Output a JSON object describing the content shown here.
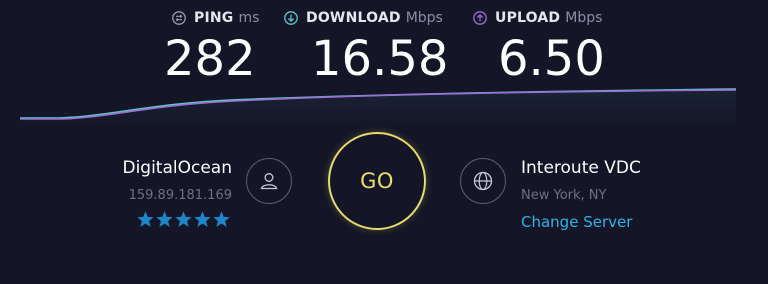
{
  "metrics": {
    "ping": {
      "label": "PING",
      "unit": "ms",
      "value": "282",
      "icon": "ping-icon"
    },
    "download": {
      "label": "DOWNLOAD",
      "unit": "Mbps",
      "value": "16.58",
      "icon": "download-arrow-icon"
    },
    "upload": {
      "label": "UPLOAD",
      "unit": "Mbps",
      "value": "6.50",
      "icon": "upload-arrow-icon"
    }
  },
  "isp": {
    "name": "DigitalOcean",
    "ip": "159.89.181.169",
    "rating": 5,
    "icon": "user-icon"
  },
  "go_button": {
    "label": "GO"
  },
  "server": {
    "name": "Interoute VDC",
    "location": "New York, NY",
    "change_label": "Change Server",
    "icon": "globe-icon"
  },
  "colors": {
    "background": "#141526",
    "download": "#5ec8c8",
    "upload": "#9b6dd6",
    "go": "#e6dc6a",
    "link": "#2fb4e8",
    "star": "#1e86c8",
    "muted": "#6e7085"
  }
}
